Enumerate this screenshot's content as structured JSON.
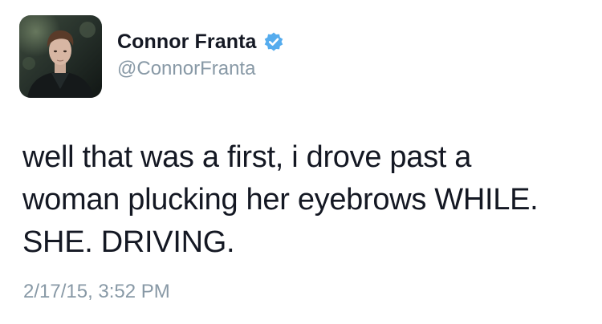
{
  "tweet": {
    "author": {
      "display_name": "Connor Franta",
      "handle": "@ConnorFranta",
      "verified": true,
      "avatar_icon": "profile-photo",
      "verified_icon": "verified-badge-icon"
    },
    "text": "well that was a first, i drove past a\nwoman plucking her eyebrows WHILE.\nSHE. DRIVING.",
    "timestamp": "2/17/15, 3:52 PM"
  },
  "colors": {
    "text": "#141823",
    "secondary_text": "#8899a6",
    "verified_blue": "#55acee",
    "background": "#ffffff"
  }
}
